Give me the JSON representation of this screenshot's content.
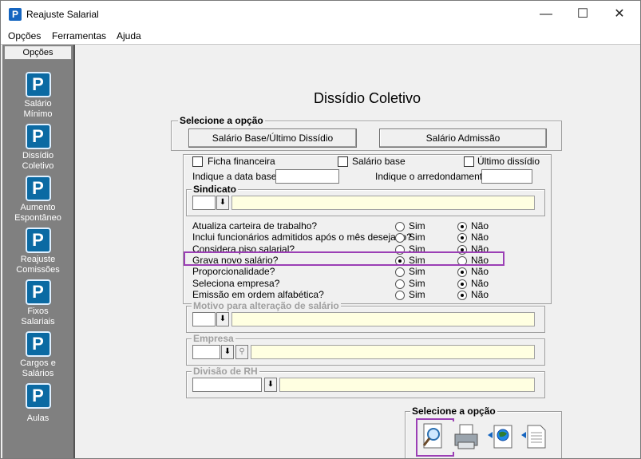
{
  "window": {
    "title": "Reajuste Salarial",
    "min": "—",
    "max": "☐",
    "close": "✕"
  },
  "menu": [
    "Opções",
    "Ferramentas",
    "Ajuda"
  ],
  "sidebar": {
    "header": "Opções",
    "items": [
      {
        "line1": "Salário",
        "line2": "Mínimo"
      },
      {
        "line1": "Dissídio",
        "line2": "Coletivo"
      },
      {
        "line1": "Aumento",
        "line2": "Espontâneo"
      },
      {
        "line1": "Reajuste",
        "line2": "Comissões"
      },
      {
        "line1": "Fixos",
        "line2": "Salariais"
      },
      {
        "line1": "Cargos e",
        "line2": "Salários"
      },
      {
        "line1": "Aulas",
        "line2": ""
      }
    ]
  },
  "main": {
    "heading": "Dissídio Coletivo",
    "option_group": {
      "label": "Selecione a opção",
      "button1": "Salário Base/Último Dissídio",
      "button2": "Salário Admissão"
    },
    "checkboxes": [
      {
        "label": "Ficha financeira",
        "checked": false
      },
      {
        "label": "Salário base",
        "checked": false
      },
      {
        "label": "Último dissídio",
        "checked": false
      }
    ],
    "data_base_label": "Indique a data base:",
    "data_base_value": "",
    "arredondamento_label": "Indique o arredondamento:",
    "arredondamento_value": "",
    "sindicato_label": "Sindicato",
    "questions": [
      {
        "label": "Atualiza carteira de trabalho?",
        "selected": "Não"
      },
      {
        "label": "Inclui funcionários admitidos após o mês desejado?",
        "selected": "Não"
      },
      {
        "label": "Considera piso salarial?",
        "selected": "Não"
      },
      {
        "label": "Grava novo salário?",
        "selected": "Sim"
      },
      {
        "label": "Proporcionalidade?",
        "selected": "Não"
      },
      {
        "label": "Seleciona empresa?",
        "selected": "Não"
      },
      {
        "label": "Emissão em ordem alfabética?",
        "selected": "Não"
      }
    ],
    "sim_label": "Sim",
    "nao_label": "Não",
    "motivo_label": "Motivo para alteração de salário",
    "empresa_label": "Empresa",
    "divisao_label": "Divisão de RH",
    "output_group_label": "Selecione a opção"
  },
  "icons": {
    "app": "p-logo-icon",
    "sidebar": "p-logo-icon",
    "preview": "magnifier-icon",
    "print": "printer-icon",
    "export": "globe-export-icon",
    "document": "document-icon"
  },
  "colors": {
    "highlight": "#9b3fb5",
    "sidebar_bg": "#808080",
    "field_yellow": "#ffffe1",
    "icon_blue": "#0b6aa3"
  }
}
